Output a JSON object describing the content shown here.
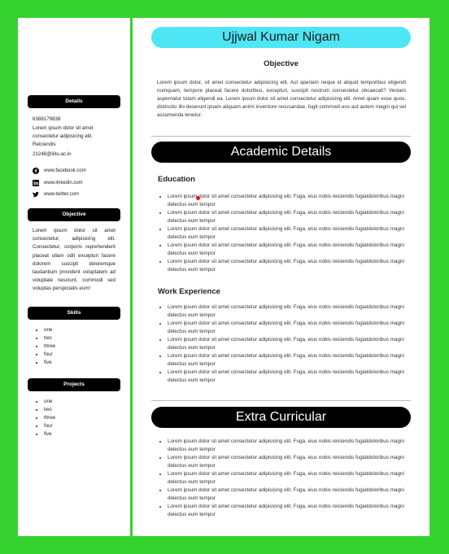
{
  "name": "Ujjwal Kumar Nigam",
  "objective": {
    "title": "Objective",
    "body": "Lorem ipsum dolor, sit amet consectetur adipisicing elit. Aut aperiam neque id aliquid temporibus eligendi numquam, tempore placeat facere doloribus, excepturi, suscipit nostrum consectetur obcaecati? Veniam aspernatur totam eligendi ea. Lorem ipsum dolor sit amet consectetur adipisicing elit. Amet quam esse quos, distinctio illo deserunt ipsam aliquam animi inventore recusandae, fugit commodi eos aut autem magni qui vel assumenda tenetur."
  },
  "sidebar": {
    "details_heading": "Details",
    "phone": "6388179838",
    "address": "Lorem ipsum dolor sit amet consectetur adipisicing elit. Reiciendis",
    "email": "21248@iiitu.ac.in",
    "socials": [
      {
        "icon": "facebook-icon",
        "label": "www.facebook.com"
      },
      {
        "icon": "linkedin-icon",
        "label": "www.linkedin.com"
      },
      {
        "icon": "twitter-icon",
        "label": "www.twitter.com"
      }
    ],
    "objective_heading": "Objective",
    "objective_text": "Lorem ipsum dolor sit amet consectetur, adipisicing elit. Consectetur, corporis reprehenderit placeat ullam odit excepturi facere dolorem suscipit doloremque laudantium provident voluptatem ad voluptate nesciunt, commodi sed voluptas perspiciatis eum!",
    "skills_heading": "Skills",
    "skills": [
      "one",
      "two",
      "three",
      "four",
      "five"
    ],
    "projects_heading": "Projects",
    "projects": [
      "one",
      "two",
      "three",
      "four",
      "five"
    ]
  },
  "academic": {
    "heading": "Academic Details",
    "education_title": "Education",
    "education": [
      "Lorem ipsum dolor sit amet consectetur adipisicing elit. Fuga, eius nobis reiciendis fugiatdoloribus magni delectus eum tempor",
      "Lorem ipsum dolor sit amet consectetur adipisicing elit. Fuga, eius nobis reiciendis fugiatdoloribus magni delectus eum tempor",
      "Lorem ipsum dolor sit amet consectetur adipisicing elit. Fuga, eius nobis reiciendis fugiatdoloribus magni delectus eum tempor",
      "Lorem ipsum dolor sit amet consectetur adipisicing elit. Fuga, eius nobis reiciendis fugiatdoloribus magni delectus eum tempor",
      "Lorem ipsum dolor sit amet consectetur adipisicing elit. Fuga, eius nobis reiciendis fugiatdoloribus magni delectus eum tempor"
    ],
    "work_title": "Work Experience",
    "work": [
      "Lorem ipsum dolor sit amet consectetur adipisicing elit. Fuga, eius nobis reiciendis fugiatdoloribus magni delectus eum tempor",
      "Lorem ipsum dolor sit amet consectetur adipisicing elit. Fuga, eius nobis reiciendis fugiatdoloribus magni delectus eum tempor",
      "Lorem ipsum dolor sit amet consectetur adipisicing elit. Fuga, eius nobis reiciendis fugiatdoloribus magni delectus eum tempor",
      "Lorem ipsum dolor sit amet consectetur adipisicing elit. Fuga, eius nobis reiciendis fugiatdoloribus magni delectus eum tempor",
      "Lorem ipsum dolor sit amet consectetur adipisicing elit. Fuga, eius nobis reiciendis fugiatdoloribus magni delectus eum tempor"
    ]
  },
  "extra": {
    "heading": "Extra Curricular",
    "items": [
      "Lorem ipsum dolor sit amet consectetur adipisicing elit. Fuga, eius nobis reiciendis fugiatdoloribus magni delectus eum tempor",
      "Lorem ipsum dolor sit amet consectetur adipisicing elit. Fuga, eius nobis reiciendis fugiatdoloribus magni delectus eum tempor",
      "Lorem ipsum dolor sit amet consectetur adipisicing elit. Fuga, eius nobis reiciendis fugiatdoloribus magni delectus eum tempor",
      "Lorem ipsum dolor sit amet consectetur adipisicing elit. Fuga, eius nobis reiciendis fugiatdoloribus magni delectus eum tempor",
      "Lorem ipsum dolor sit amet consectetur adipisicing elit. Fuga, eius nobis reiciendis fugiatdoloribus magni delectus eum tempor"
    ]
  },
  "colors": {
    "frame": "#35d22f",
    "name_bar": "#4ee6f5",
    "section_bar": "#000000"
  }
}
